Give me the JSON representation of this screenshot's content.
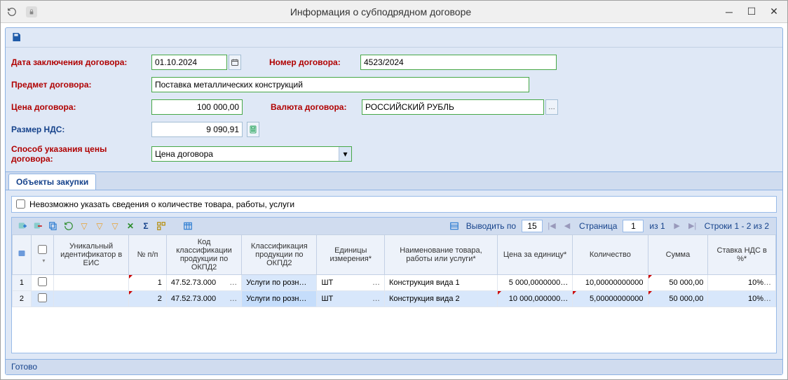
{
  "window": {
    "title": "Информация о субподрядном договоре"
  },
  "form": {
    "contract_date_label": "Дата заключения договора:",
    "contract_date": "01.10.2024",
    "contract_number_label": "Номер договора:",
    "contract_number": "4523/2024",
    "subject_label": "Предмет договора:",
    "subject": "Поставка металлических конструкций",
    "price_label": "Цена договора:",
    "price": "100 000,00",
    "currency_label": "Валюта договора:",
    "currency": "РОССИЙСКИЙ РУБЛЬ",
    "vat_label": "Размер НДС:",
    "vat": "9 090,91",
    "method_label": "Способ указания цены договора:",
    "method": "Цена договора"
  },
  "tab": {
    "label": "Объекты закупки"
  },
  "checkbox": {
    "label": "Невозможно указать сведения о количестве товара, работы, услуги"
  },
  "pager": {
    "per_page_label": "Выводить по",
    "per_page": "15",
    "page_label": "Страница",
    "page": "1",
    "of_label": "из 1",
    "rows_label": "Строки 1 - 2 из 2"
  },
  "columns": {
    "uid": "Уникальный идентификатор в ЕИС",
    "num": "№ п/п",
    "okpd_code": "Код классификации продукции по ОКПД2",
    "okpd_class": "Классификация продукции по ОКПД2",
    "unit": "Единицы измерения*",
    "name": "Наименование товара, работы или услуги*",
    "unit_price": "Цена за единицу*",
    "qty": "Количество",
    "sum": "Сумма",
    "vat_rate": "Ставка НДС в %*"
  },
  "rows": [
    {
      "rn": "1",
      "num": "1",
      "okpd_code": "47.52.73.000",
      "okpd_class": "Услуги по розн…",
      "unit": "ШТ",
      "name": "Конструкция вида 1",
      "unit_price": "5 000,0000000…",
      "qty": "10,00000000000",
      "sum": "50 000,00",
      "vat_rate": "10%"
    },
    {
      "rn": "2",
      "num": "2",
      "okpd_code": "47.52.73.000",
      "okpd_class": "Услуги по розн…",
      "unit": "ШТ",
      "name": "Конструкция вида 2",
      "unit_price": "10 000,000000…",
      "qty": "5,00000000000",
      "sum": "50 000,00",
      "vat_rate": "10%"
    }
  ],
  "status": "Готово"
}
